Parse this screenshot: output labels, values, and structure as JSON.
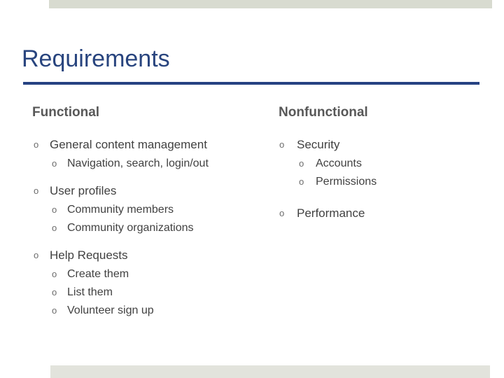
{
  "slide": {
    "title": "Requirements",
    "accent_color": "#264282",
    "title_color": "#28447e",
    "band_color": "#d8dbd0",
    "band_bottom_color": "#e2e3dc",
    "heading_color": "#585858",
    "body_color": "#414141",
    "bullet_glyph": "o"
  },
  "columns": {
    "left": {
      "heading": "Functional",
      "groups": [
        {
          "lead": "General content management",
          "children": [
            "Navigation, search, login/out"
          ]
        },
        {
          "lead": "User profiles",
          "children": [
            "Community members",
            "Community organizations"
          ]
        },
        {
          "lead": "Help Requests",
          "children": [
            "Create them",
            "List them",
            "Volunteer sign up"
          ]
        }
      ]
    },
    "right": {
      "heading": "Nonfunctional",
      "groups": [
        {
          "lead": "Security",
          "children": [
            "Accounts",
            "Permissions"
          ]
        },
        {
          "lead": "Performance",
          "children": []
        }
      ]
    }
  }
}
